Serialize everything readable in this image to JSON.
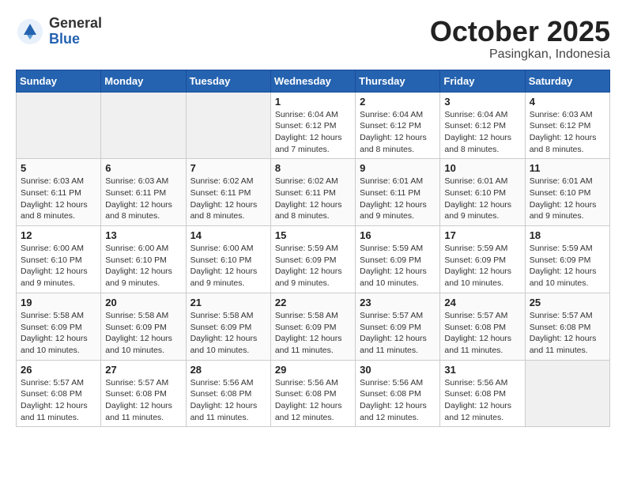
{
  "header": {
    "logo_general": "General",
    "logo_blue": "Blue",
    "month": "October 2025",
    "location": "Pasingkan, Indonesia"
  },
  "weekdays": [
    "Sunday",
    "Monday",
    "Tuesday",
    "Wednesday",
    "Thursday",
    "Friday",
    "Saturday"
  ],
  "weeks": [
    [
      {
        "day": "",
        "info": ""
      },
      {
        "day": "",
        "info": ""
      },
      {
        "day": "",
        "info": ""
      },
      {
        "day": "1",
        "info": "Sunrise: 6:04 AM\nSunset: 6:12 PM\nDaylight: 12 hours\nand 7 minutes."
      },
      {
        "day": "2",
        "info": "Sunrise: 6:04 AM\nSunset: 6:12 PM\nDaylight: 12 hours\nand 8 minutes."
      },
      {
        "day": "3",
        "info": "Sunrise: 6:04 AM\nSunset: 6:12 PM\nDaylight: 12 hours\nand 8 minutes."
      },
      {
        "day": "4",
        "info": "Sunrise: 6:03 AM\nSunset: 6:12 PM\nDaylight: 12 hours\nand 8 minutes."
      }
    ],
    [
      {
        "day": "5",
        "info": "Sunrise: 6:03 AM\nSunset: 6:11 PM\nDaylight: 12 hours\nand 8 minutes."
      },
      {
        "day": "6",
        "info": "Sunrise: 6:03 AM\nSunset: 6:11 PM\nDaylight: 12 hours\nand 8 minutes."
      },
      {
        "day": "7",
        "info": "Sunrise: 6:02 AM\nSunset: 6:11 PM\nDaylight: 12 hours\nand 8 minutes."
      },
      {
        "day": "8",
        "info": "Sunrise: 6:02 AM\nSunset: 6:11 PM\nDaylight: 12 hours\nand 8 minutes."
      },
      {
        "day": "9",
        "info": "Sunrise: 6:01 AM\nSunset: 6:11 PM\nDaylight: 12 hours\nand 9 minutes."
      },
      {
        "day": "10",
        "info": "Sunrise: 6:01 AM\nSunset: 6:10 PM\nDaylight: 12 hours\nand 9 minutes."
      },
      {
        "day": "11",
        "info": "Sunrise: 6:01 AM\nSunset: 6:10 PM\nDaylight: 12 hours\nand 9 minutes."
      }
    ],
    [
      {
        "day": "12",
        "info": "Sunrise: 6:00 AM\nSunset: 6:10 PM\nDaylight: 12 hours\nand 9 minutes."
      },
      {
        "day": "13",
        "info": "Sunrise: 6:00 AM\nSunset: 6:10 PM\nDaylight: 12 hours\nand 9 minutes."
      },
      {
        "day": "14",
        "info": "Sunrise: 6:00 AM\nSunset: 6:10 PM\nDaylight: 12 hours\nand 9 minutes."
      },
      {
        "day": "15",
        "info": "Sunrise: 5:59 AM\nSunset: 6:09 PM\nDaylight: 12 hours\nand 9 minutes."
      },
      {
        "day": "16",
        "info": "Sunrise: 5:59 AM\nSunset: 6:09 PM\nDaylight: 12 hours\nand 10 minutes."
      },
      {
        "day": "17",
        "info": "Sunrise: 5:59 AM\nSunset: 6:09 PM\nDaylight: 12 hours\nand 10 minutes."
      },
      {
        "day": "18",
        "info": "Sunrise: 5:59 AM\nSunset: 6:09 PM\nDaylight: 12 hours\nand 10 minutes."
      }
    ],
    [
      {
        "day": "19",
        "info": "Sunrise: 5:58 AM\nSunset: 6:09 PM\nDaylight: 12 hours\nand 10 minutes."
      },
      {
        "day": "20",
        "info": "Sunrise: 5:58 AM\nSunset: 6:09 PM\nDaylight: 12 hours\nand 10 minutes."
      },
      {
        "day": "21",
        "info": "Sunrise: 5:58 AM\nSunset: 6:09 PM\nDaylight: 12 hours\nand 10 minutes."
      },
      {
        "day": "22",
        "info": "Sunrise: 5:58 AM\nSunset: 6:09 PM\nDaylight: 12 hours\nand 11 minutes."
      },
      {
        "day": "23",
        "info": "Sunrise: 5:57 AM\nSunset: 6:09 PM\nDaylight: 12 hours\nand 11 minutes."
      },
      {
        "day": "24",
        "info": "Sunrise: 5:57 AM\nSunset: 6:08 PM\nDaylight: 12 hours\nand 11 minutes."
      },
      {
        "day": "25",
        "info": "Sunrise: 5:57 AM\nSunset: 6:08 PM\nDaylight: 12 hours\nand 11 minutes."
      }
    ],
    [
      {
        "day": "26",
        "info": "Sunrise: 5:57 AM\nSunset: 6:08 PM\nDaylight: 12 hours\nand 11 minutes."
      },
      {
        "day": "27",
        "info": "Sunrise: 5:57 AM\nSunset: 6:08 PM\nDaylight: 12 hours\nand 11 minutes."
      },
      {
        "day": "28",
        "info": "Sunrise: 5:56 AM\nSunset: 6:08 PM\nDaylight: 12 hours\nand 11 minutes."
      },
      {
        "day": "29",
        "info": "Sunrise: 5:56 AM\nSunset: 6:08 PM\nDaylight: 12 hours\nand 12 minutes."
      },
      {
        "day": "30",
        "info": "Sunrise: 5:56 AM\nSunset: 6:08 PM\nDaylight: 12 hours\nand 12 minutes."
      },
      {
        "day": "31",
        "info": "Sunrise: 5:56 AM\nSunset: 6:08 PM\nDaylight: 12 hours\nand 12 minutes."
      },
      {
        "day": "",
        "info": ""
      }
    ]
  ]
}
